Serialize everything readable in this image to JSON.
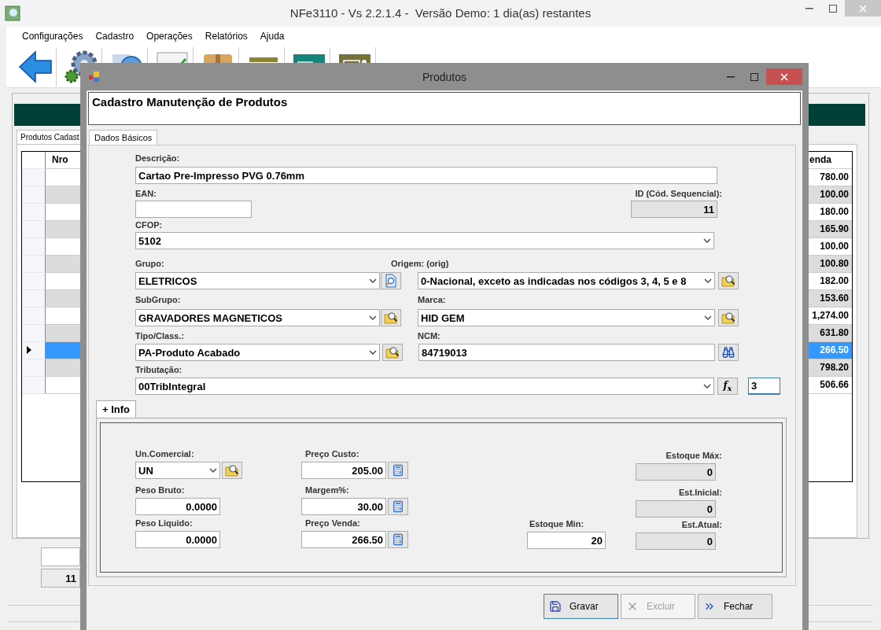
{
  "window": {
    "title": "NFe3110 - Vs 2.2.1.4 -  Versão Demo: 1 dia(as) restantes"
  },
  "menu": [
    "Configurações",
    "Cadastro",
    "Operações",
    "Relatórios",
    "Ajuda"
  ],
  "main": {
    "tab": {
      "label": "Produtos Cadast",
      "selected": true
    },
    "grid": {
      "columns": [
        "Nro",
        "enda"
      ],
      "rows": [
        {
          "selected": false,
          "value": "780.00"
        },
        {
          "selected": false,
          "value": "100.00"
        },
        {
          "selected": false,
          "value": "180.00"
        },
        {
          "selected": false,
          "value": "165.90"
        },
        {
          "selected": false,
          "value": "100.00"
        },
        {
          "selected": false,
          "value": "100.80"
        },
        {
          "selected": false,
          "value": "182.00"
        },
        {
          "selected": false,
          "value": "153.60"
        },
        {
          "selected": false,
          "value": "1,274.00"
        },
        {
          "selected": false,
          "value": "631.80"
        },
        {
          "selected": true,
          "value": "266.50"
        },
        {
          "selected": false,
          "value": "798.20"
        },
        {
          "selected": false,
          "value": "506.66"
        }
      ]
    },
    "footer_count": "11"
  },
  "dialog": {
    "title": "Produtos",
    "header": "Cadastro Manutenção de Produtos",
    "tabs": [
      {
        "label": "Dados Básicos",
        "selected": true
      }
    ],
    "basic": {
      "descricao": {
        "label": "Descrição:",
        "value": "Cartao Pre-Impresso PVG 0.76mm"
      },
      "ean": {
        "label": "EAN:"
      },
      "id": {
        "label": "ID (Cód. Sequencial):",
        "value": "11"
      },
      "cfop": {
        "label": "CFOP:",
        "value": "5102"
      },
      "grupo": {
        "label": "Grupo:",
        "value": "ELETRICOS"
      },
      "origem": {
        "label": "Origem: (orig)",
        "value": "0-Nacional, exceto as indicadas nos códigos 3, 4, 5 e 8"
      },
      "subgrupo": {
        "label": "SubGrupo:",
        "value": "GRAVADORES MAGNETICOS"
      },
      "marca": {
        "label": "Marca:",
        "value": "HID GEM"
      },
      "tipo": {
        "label": "Tipo/Class.:",
        "value": "PA-Produto Acabado"
      },
      "ncm": {
        "label": "NCM:",
        "value": "84719013"
      },
      "tributacao": {
        "label": "Tributação:",
        "value": "00TribIntegral"
      },
      "formula_button": "f$_{x}$",
      "tributacao_code": {
        "value": "3",
        "focused": true
      }
    },
    "info_tab": {
      "label": "+ Info",
      "selected": true
    },
    "info": {
      "un_comercial": {
        "label": "Un.Comercial:",
        "value": "UN"
      },
      "peso_bruto": {
        "label": "Peso Bruto:",
        "value": "0.0000"
      },
      "peso_liquido": {
        "label": "Peso Liquido:",
        "value": "0.0000"
      },
      "preco_custo": {
        "label": "Preço Custo:",
        "value": "205.00"
      },
      "margem": {
        "label": "Margem%:",
        "value": "30.00"
      },
      "preco_venda": {
        "label": "Preço Venda:",
        "value": "266.50"
      },
      "estoque_min": {
        "label": "Estoque Min:",
        "value": "20"
      },
      "estoque_max": {
        "label": "Estoque Máx:",
        "value": "0"
      },
      "est_inicial": {
        "label": "Est.Inicial:",
        "value": "0"
      },
      "est_atual": {
        "label": "Est.Atual:",
        "value": "0"
      }
    },
    "buttons": [
      {
        "kind": "save",
        "label": "Gravar",
        "default": true,
        "disabled": false
      },
      {
        "kind": "delete",
        "label": "Excluir",
        "default": false,
        "disabled": true
      },
      {
        "kind": "close",
        "label": "Fechar",
        "default": false,
        "disabled": false
      }
    ]
  }
}
